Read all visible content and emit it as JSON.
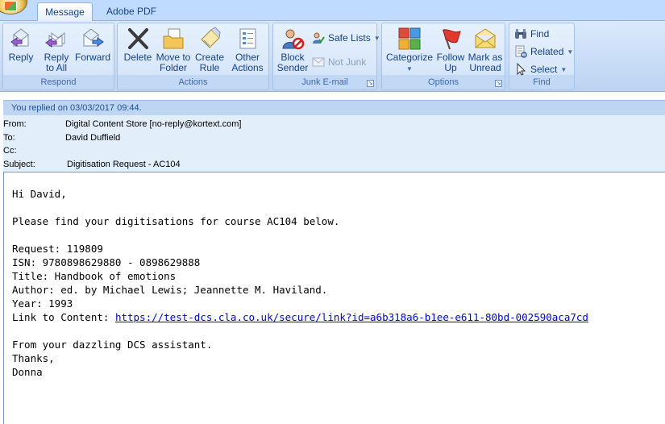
{
  "tabs": [
    {
      "label": "Message",
      "active": true
    },
    {
      "label": "Adobe PDF",
      "active": false
    }
  ],
  "groups": {
    "respond": {
      "label": "Respond",
      "buttons": [
        "Reply",
        "Reply\nto All",
        "Forward"
      ]
    },
    "actions": {
      "label": "Actions",
      "buttons": [
        "Delete",
        "Move to\nFolder",
        "Create\nRule",
        "Other\nActions"
      ]
    },
    "junk": {
      "label": "Junk E-mail",
      "block_sender": "Block\nSender",
      "safe_lists": "Safe Lists",
      "not_junk": "Not Junk"
    },
    "options": {
      "label": "Options",
      "buttons": [
        "Categorize",
        "Follow\nUp",
        "Mark as\nUnread"
      ]
    },
    "find": {
      "label": "Find",
      "find": "Find",
      "related": "Related",
      "select": "Select"
    }
  },
  "infobar": "You replied on 03/03/2017 09:44.",
  "headers": {
    "from_label": "From:",
    "from": "Digital Content Store [no-reply@kortext.com]",
    "to_label": "To:",
    "to": "David Duffield",
    "cc_label": "Cc:",
    "cc": "",
    "subject_label": "Subject:",
    "subject": "Digitisation Request - AC104"
  },
  "body": {
    "greeting": "Hi David,",
    "intro": "Please find your digitisations for course AC104 below.",
    "request": "Request: 119809",
    "isn": "ISN: 9780898629880 - 0898629888",
    "title": "Title: Handbook of emotions",
    "author": "Author: ed. by Michael Lewis; Jeannette M. Haviland.",
    "year": "Year: 1993",
    "link_label": "Link to Content: ",
    "link": "https://test-dcs.cla.co.uk/secure/link?id=a6b318a6-b1ee-e611-80bd-002590aca7cd",
    "closing": "From your dazzling DCS assistant.",
    "thanks": "Thanks,",
    "signature": "Donna"
  },
  "colors": {
    "ribbon_text": "#15428b",
    "link": "#0000ee",
    "header_bg": "#e3eefb"
  }
}
